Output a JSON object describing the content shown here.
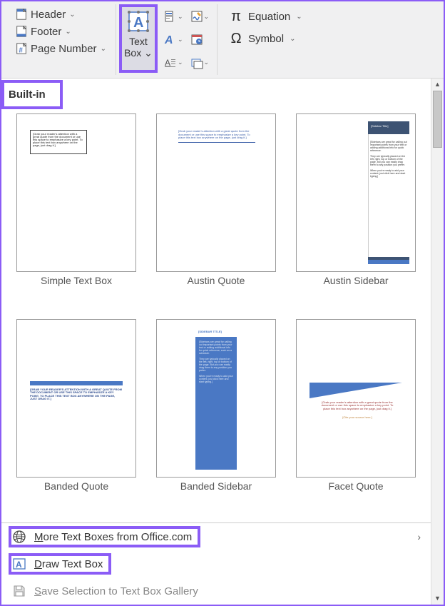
{
  "ribbon": {
    "header_label": "Header",
    "footer_label": "Footer",
    "page_number_label": "Page Number",
    "textbox_label": "Text\nBox",
    "equation_label": "Equation",
    "symbol_label": "Symbol"
  },
  "gallery": {
    "heading": "Built-in",
    "items": [
      {
        "label": "Simple Text Box"
      },
      {
        "label": "Austin Quote"
      },
      {
        "label": "Austin Sidebar"
      },
      {
        "label": "Banded Quote"
      },
      {
        "label": "Banded Sidebar"
      },
      {
        "label": "Facet Quote"
      }
    ]
  },
  "footer": {
    "more": "More Text Boxes from Office.com",
    "draw": "Draw Text Box",
    "save": "Save Selection to Text Box Gallery"
  },
  "colors": {
    "highlight": "#8B5CF6",
    "accent": "#4a78c4"
  }
}
